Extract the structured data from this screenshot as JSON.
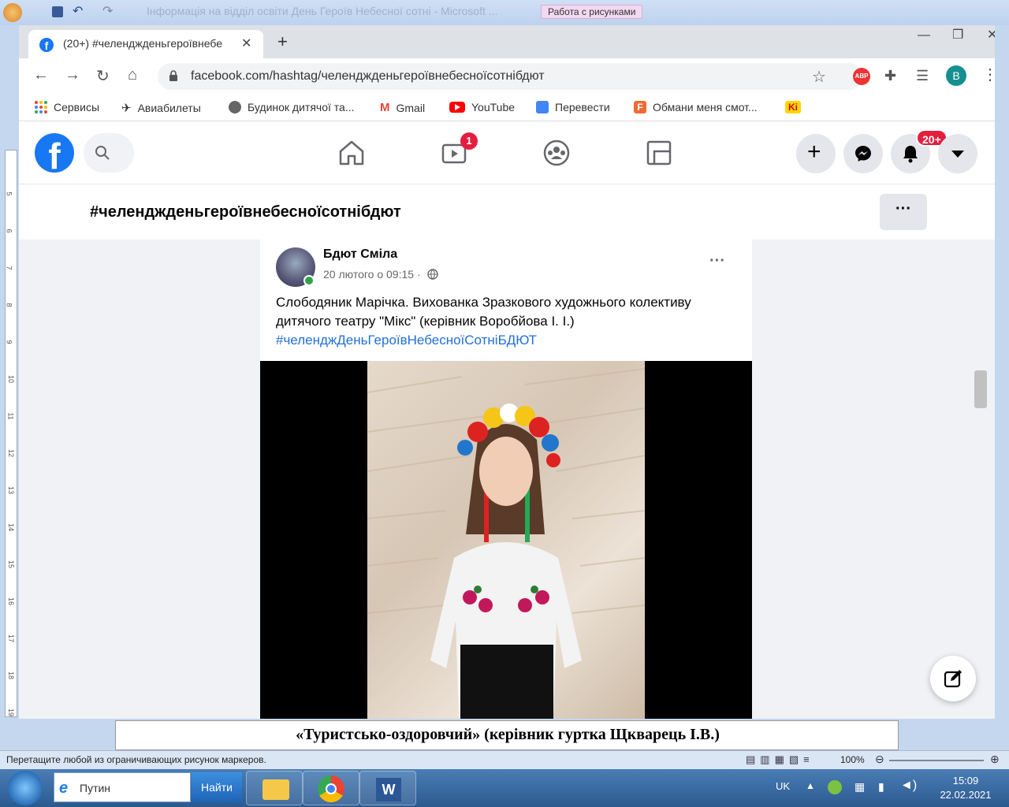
{
  "word": {
    "title": "Інформація на відділ освіти День Героїв Небесної сотні - Microsoft ...",
    "context_tab": "Работа с рисунками",
    "doc_line": "«Туристсько-оздоровчий» (керівник гуртка Щкварець І.В.)",
    "status_text": "Перетащите любой из ограничивающих рисунок маркеров.",
    "zoom": "100%",
    "ruler_numbers": [
      "5",
      "6",
      "7",
      "8",
      "9",
      "10",
      "11",
      "12",
      "13",
      "14",
      "15",
      "16",
      "17",
      "18",
      "19"
    ]
  },
  "chrome": {
    "tab_title": "(20+) #челенджденьгероївнебе",
    "url": "facebook.com/hashtag/челенджденьгероївнебесноїсотнібдют",
    "profile_initial": "B",
    "abp_label": "ABP",
    "bookmarks": [
      {
        "label": "Сервисы",
        "icon": "apps-grid-icon",
        "color": "#e94235"
      },
      {
        "label": "Авиабилеты",
        "icon": "plane-icon",
        "color": "#222222"
      },
      {
        "label": "Будинок дитячої та...",
        "icon": "globe-icon",
        "color": "#666666"
      },
      {
        "label": "Gmail",
        "icon": "gmail-icon",
        "color": "#ea4335"
      },
      {
        "label": "YouTube",
        "icon": "youtube-icon",
        "color": "#ff0000"
      },
      {
        "label": "Перевести",
        "icon": "translate-icon",
        "color": "#4285f4"
      },
      {
        "label": "Обмани меня смот...",
        "icon": "f-icon",
        "color": "#f06a35"
      },
      {
        "label": "",
        "icon": "ki-icon",
        "color": "#ffd600"
      }
    ]
  },
  "facebook": {
    "watch_badge": "1",
    "notif_badge": "20+",
    "hashtag_title": "#челенджденьгероївнебесноїсотнібдют",
    "post": {
      "author": "Бдют Сміла",
      "date": "20 лютого о 09:15 ·",
      "text": "Слободяник Марічка. Вихованка Зразкового художнього колективу дитячого театру \"Мікс\" (керівник Воробйова І. І.)",
      "hashtag": "#челенджДеньГероївНебесноїСотніБДЮТ"
    }
  },
  "taskbar": {
    "search_text": "Путин",
    "search_button": "Найти",
    "lang": "UK",
    "time": "15:09",
    "date": "22.02.2021"
  }
}
